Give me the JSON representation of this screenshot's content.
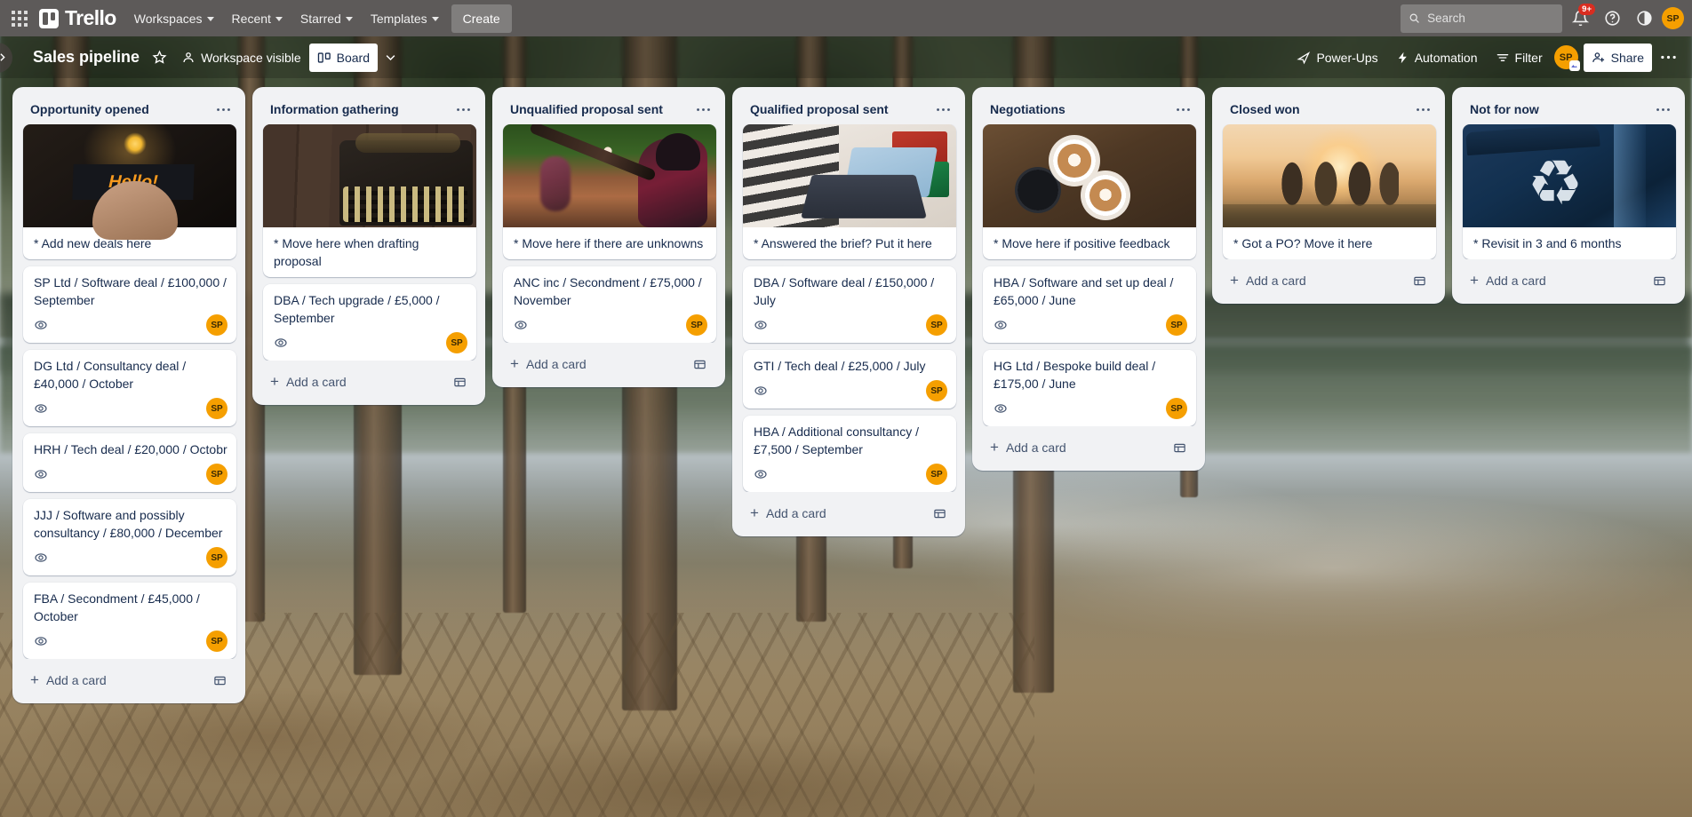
{
  "topnav": {
    "apps_icon": "grid-apps-icon",
    "brand": "Trello",
    "menus": [
      {
        "label": "Workspaces"
      },
      {
        "label": "Recent"
      },
      {
        "label": "Starred"
      },
      {
        "label": "Templates"
      }
    ],
    "create_label": "Create",
    "search": {
      "placeholder": "Search",
      "value": "",
      "icon": "search-icon"
    },
    "notifications": {
      "icon": "bell-icon",
      "badge": "9+"
    },
    "help": {
      "icon": "help-circle-icon"
    },
    "theme": {
      "icon": "theme-contrast-icon"
    },
    "avatar": {
      "initials": "SP",
      "color": "#f59f00"
    }
  },
  "boardbar": {
    "sidebar_toggle_icon": "chevron-right-icon",
    "title": "Sales pipeline",
    "star_icon": "star-outline-icon",
    "visibility": {
      "label": "Workspace visible",
      "icon": "people-icon"
    },
    "view": {
      "label": "Board",
      "icon": "board-view-icon"
    },
    "view_caret_icon": "chevron-down-icon",
    "powerups": {
      "label": "Power-Ups",
      "icon": "rocket-icon"
    },
    "automation": {
      "label": "Automation",
      "icon": "lightning-icon"
    },
    "filter": {
      "label": "Filter",
      "icon": "filter-icon"
    },
    "member_avatar": {
      "initials": "SP",
      "color": "#f59f00"
    },
    "share": {
      "label": "Share",
      "icon": "person-add-icon"
    },
    "overflow_icon": "ellipsis-horizontal-icon"
  },
  "common": {
    "add_card_label": "Add a card",
    "add_card_plus_icon": "plus-icon",
    "card_template_icon": "card-template-icon",
    "list_menu_icon": "ellipsis-horizontal-icon",
    "watch_icon": "eye-watch-icon",
    "member_initials": "SP"
  },
  "lists": [
    {
      "title": "Opportunity opened",
      "cards": [
        {
          "title": "* Add new deals here",
          "cover": "cov-hello",
          "cover_art": "hello-sign-photo",
          "watch": false,
          "member": false
        },
        {
          "title": "SP Ltd / Software deal / £100,000 / September",
          "watch": true,
          "member": true
        },
        {
          "title": "DG Ltd / Consultancy deal / £40,000 / October",
          "watch": true,
          "member": true
        },
        {
          "title": "HRH / Tech deal / £20,000 / Octobr",
          "watch": true,
          "member": true
        },
        {
          "title": "JJJ / Software and possibly consultancy / £80,000 / December",
          "watch": true,
          "member": true
        },
        {
          "title": "FBA / Secondment / £45,000 / October",
          "watch": true,
          "member": true
        }
      ]
    },
    {
      "title": "Information gathering",
      "cards": [
        {
          "title": "* Move here when drafting proposal",
          "cover": "cov-typewriter",
          "cover_art": "typewriter-photo",
          "watch": false,
          "member": false
        },
        {
          "title": "DBA / Tech upgrade / £5,000 / September",
          "watch": true,
          "member": true
        }
      ]
    },
    {
      "title": "Unqualified proposal sent",
      "cards": [
        {
          "title": "* Move here if there are unknowns",
          "cover": "cov-baseball",
          "cover_art": "baseball-batter-photo",
          "watch": false,
          "member": false
        },
        {
          "title": "ANC inc / Secondment / £75,000 / November",
          "watch": true,
          "member": true
        }
      ]
    },
    {
      "title": "Qualified proposal sent",
      "cards": [
        {
          "title": "* Answered the brief? Put it here",
          "cover": "cov-laptop",
          "cover_art": "laptop-gifts-photo",
          "watch": false,
          "member": false
        },
        {
          "title": "DBA / Software deal / £150,000 / July",
          "watch": true,
          "member": true
        },
        {
          "title": "GTI / Tech deal / £25,000 / July",
          "watch": true,
          "member": true
        },
        {
          "title": "HBA / Additional consultancy / £7,500 / September",
          "watch": true,
          "member": true
        }
      ]
    },
    {
      "title": "Negotiations",
      "cards": [
        {
          "title": "* Move here if positive feedback",
          "cover": "cov-coffee",
          "cover_art": "coffee-cheers-photo",
          "watch": false,
          "member": false
        },
        {
          "title": "HBA / Software and set up deal / £65,000 / June",
          "watch": true,
          "member": true
        },
        {
          "title": "HG Ltd / Bespoke build deal / £175,00 / June",
          "watch": true,
          "member": true
        }
      ]
    },
    {
      "title": "Closed won",
      "cards": [
        {
          "title": "* Got a PO? Move it here",
          "cover": "cov-sunset",
          "cover_art": "friends-sunset-photo",
          "watch": false,
          "member": false
        }
      ]
    },
    {
      "title": "Not for now",
      "cards": [
        {
          "title": "* Revisit in 3 and 6 months",
          "cover": "cov-recycle",
          "cover_art": "recycling-bin-photo",
          "watch": false,
          "member": false
        }
      ]
    }
  ]
}
